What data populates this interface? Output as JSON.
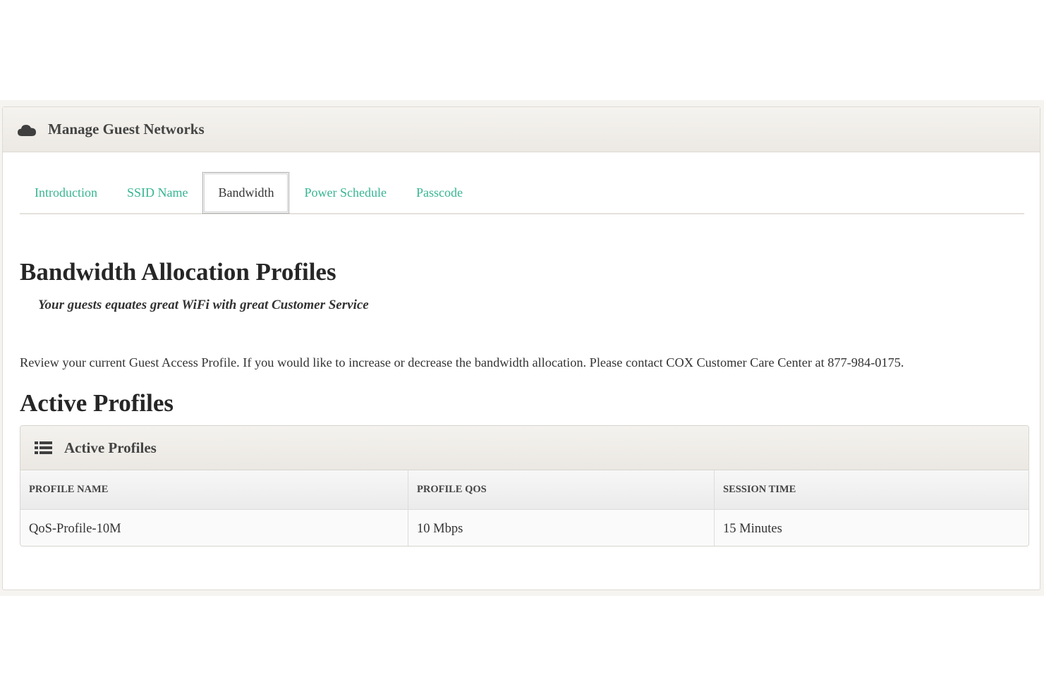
{
  "panel": {
    "title": "Manage Guest Networks",
    "icon": "cloud-icon"
  },
  "tabs": [
    {
      "label": "Introduction",
      "active": false
    },
    {
      "label": "SSID Name",
      "active": false
    },
    {
      "label": "Bandwidth",
      "active": true
    },
    {
      "label": "Power Schedule",
      "active": false
    },
    {
      "label": "Passcode",
      "active": false
    }
  ],
  "content": {
    "heading": "Bandwidth Allocation Profiles",
    "subtitle": "Your guests equates great WiFi with great Customer Service",
    "description": "Review your current Guest Access Profile. If you would like to increase or decrease the bandwidth allocation. Please contact COX Customer Care Center at 877-984-0175.",
    "active_heading": "Active Profiles"
  },
  "profiles_table": {
    "title": "Active Profiles",
    "icon": "list-icon",
    "columns": [
      "PROFILE NAME",
      "PROFILE QOS",
      "SESSION TIME"
    ],
    "rows": [
      [
        "QoS-Profile-10M",
        "10 Mbps",
        "15 Minutes"
      ]
    ]
  },
  "colors": {
    "tab_link": "#37b592",
    "header_bg": "#efece8"
  }
}
